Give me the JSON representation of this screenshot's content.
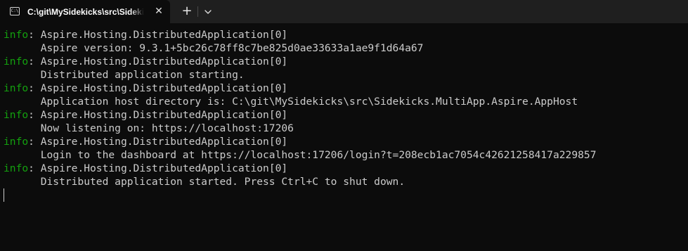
{
  "tab": {
    "title": "C:\\git\\MySidekicks\\src\\Sidekicks.MultiApp.Aspire.AppHost",
    "icon": "terminal-icon",
    "icon_glyph": "C:\\",
    "close_glyph": "✕"
  },
  "toolbar": {
    "new_tab_glyph": "+",
    "dropdown_icon": "chevron-down-icon"
  },
  "terminal": {
    "info_label": "info",
    "info_color": "#13a10e",
    "text_color": "#cccccc",
    "background": "#0c0c0c",
    "entries": [
      {
        "source": "Aspire.Hosting.DistributedApplication[0]",
        "message": "Aspire version: 9.3.1+5bc26c78ff8c7be825d0ae33633a1ae9f1d64a67"
      },
      {
        "source": "Aspire.Hosting.DistributedApplication[0]",
        "message": "Distributed application starting."
      },
      {
        "source": "Aspire.Hosting.DistributedApplication[0]",
        "message": "Application host directory is: C:\\git\\MySidekicks\\src\\Sidekicks.MultiApp.Aspire.AppHost"
      },
      {
        "source": "Aspire.Hosting.DistributedApplication[0]",
        "message": "Now listening on: https://localhost:17206"
      },
      {
        "source": "Aspire.Hosting.DistributedApplication[0]",
        "message": "Login to the dashboard at https://localhost:17206/login?t=208ecb1ac7054c42621258417a229857"
      },
      {
        "source": "Aspire.Hosting.DistributedApplication[0]",
        "message": "Distributed application started. Press Ctrl+C to shut down."
      }
    ]
  }
}
